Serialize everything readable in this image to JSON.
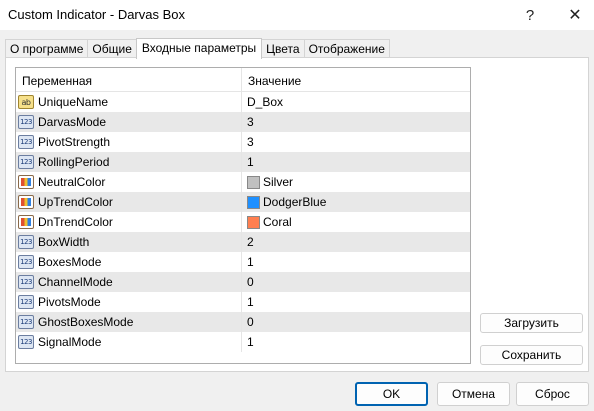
{
  "window": {
    "title": "Custom Indicator - Darvas Box",
    "help_glyph": "?",
    "close_glyph": "✕"
  },
  "tabs": [
    {
      "label": "О программе"
    },
    {
      "label": "Общие"
    },
    {
      "label": "Входные параметры",
      "active": true
    },
    {
      "label": "Цвета"
    },
    {
      "label": "Отображение"
    }
  ],
  "grid": {
    "col_variable": "Переменная",
    "col_value": "Значение",
    "rows": [
      {
        "icon": "string-icon",
        "icon_text": "ab",
        "name": "UniqueName",
        "value": "D_Box"
      },
      {
        "icon": "integer-icon",
        "icon_text": "123",
        "name": "DarvasMode",
        "value": "3"
      },
      {
        "icon": "integer-icon",
        "icon_text": "123",
        "name": "PivotStrength",
        "value": "3"
      },
      {
        "icon": "integer-icon",
        "icon_text": "123",
        "name": "RollingPeriod",
        "value": "1"
      },
      {
        "icon": "color-icon",
        "icon_text": "",
        "name": "NeutralColor",
        "value": "Silver",
        "swatch": "#c0c0c0"
      },
      {
        "icon": "color-icon",
        "icon_text": "",
        "name": "UpTrendColor",
        "value": "DodgerBlue",
        "swatch": "#1e90ff"
      },
      {
        "icon": "color-icon",
        "icon_text": "",
        "name": "DnTrendColor",
        "value": "Coral",
        "swatch": "#ff7f50"
      },
      {
        "icon": "integer-icon",
        "icon_text": "123",
        "name": "BoxWidth",
        "value": "2"
      },
      {
        "icon": "integer-icon",
        "icon_text": "123",
        "name": "BoxesMode",
        "value": "1"
      },
      {
        "icon": "integer-icon",
        "icon_text": "123",
        "name": "ChannelMode",
        "value": "0"
      },
      {
        "icon": "integer-icon",
        "icon_text": "123",
        "name": "PivotsMode",
        "value": "1"
      },
      {
        "icon": "integer-icon",
        "icon_text": "123",
        "name": "GhostBoxesMode",
        "value": "0"
      },
      {
        "icon": "integer-icon",
        "icon_text": "123",
        "name": "SignalMode",
        "value": "1"
      }
    ]
  },
  "buttons": {
    "load": "Загрузить",
    "save": "Сохранить",
    "ok": "OK",
    "cancel": "Отмена",
    "reset": "Сброс"
  }
}
